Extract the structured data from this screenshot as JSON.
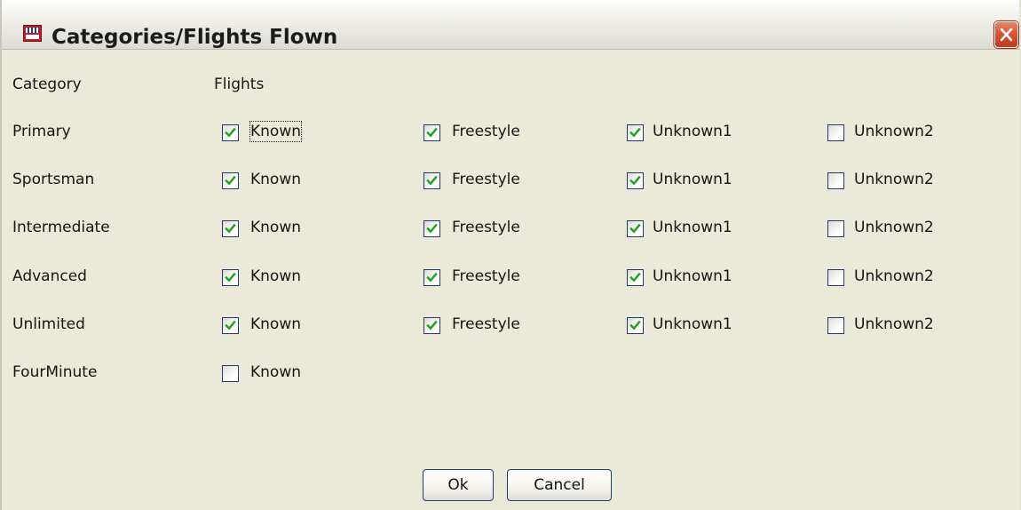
{
  "window": {
    "title": "Categories/Flights Flown"
  },
  "headers": {
    "category": "Category",
    "flights": "Flights"
  },
  "rows": [
    {
      "category": "Primary",
      "flights": [
        {
          "label": "Known",
          "checked": true
        },
        {
          "label": "Freestyle",
          "checked": true
        },
        {
          "label": "Unknown1",
          "checked": true
        },
        {
          "label": "Unknown2",
          "checked": false
        }
      ]
    },
    {
      "category": "Sportsman",
      "flights": [
        {
          "label": "Known",
          "checked": true
        },
        {
          "label": "Freestyle",
          "checked": true
        },
        {
          "label": "Unknown1",
          "checked": true
        },
        {
          "label": "Unknown2",
          "checked": false
        }
      ]
    },
    {
      "category": "Intermediate",
      "flights": [
        {
          "label": "Known",
          "checked": true
        },
        {
          "label": "Freestyle",
          "checked": true
        },
        {
          "label": "Unknown1",
          "checked": true
        },
        {
          "label": "Unknown2",
          "checked": false
        }
      ]
    },
    {
      "category": "Advanced",
      "flights": [
        {
          "label": "Known",
          "checked": true
        },
        {
          "label": "Freestyle",
          "checked": true
        },
        {
          "label": "Unknown1",
          "checked": true
        },
        {
          "label": "Unknown2",
          "checked": false
        }
      ]
    },
    {
      "category": "Unlimited",
      "flights": [
        {
          "label": "Known",
          "checked": true
        },
        {
          "label": "Freestyle",
          "checked": true
        },
        {
          "label": "Unknown1",
          "checked": true
        },
        {
          "label": "Unknown2",
          "checked": false
        }
      ]
    },
    {
      "category": "FourMinute",
      "flights": [
        {
          "label": "Known",
          "checked": false
        }
      ]
    }
  ],
  "buttons": {
    "ok": "Ok",
    "cancel": "Cancel"
  },
  "icons": {
    "app": "app-logo-icon",
    "close": "close-icon",
    "check": "checkmark-icon"
  },
  "colors": {
    "dialog_background": "#ebe9d8",
    "checkmark": "#21a121",
    "close_button": "#d85433"
  }
}
